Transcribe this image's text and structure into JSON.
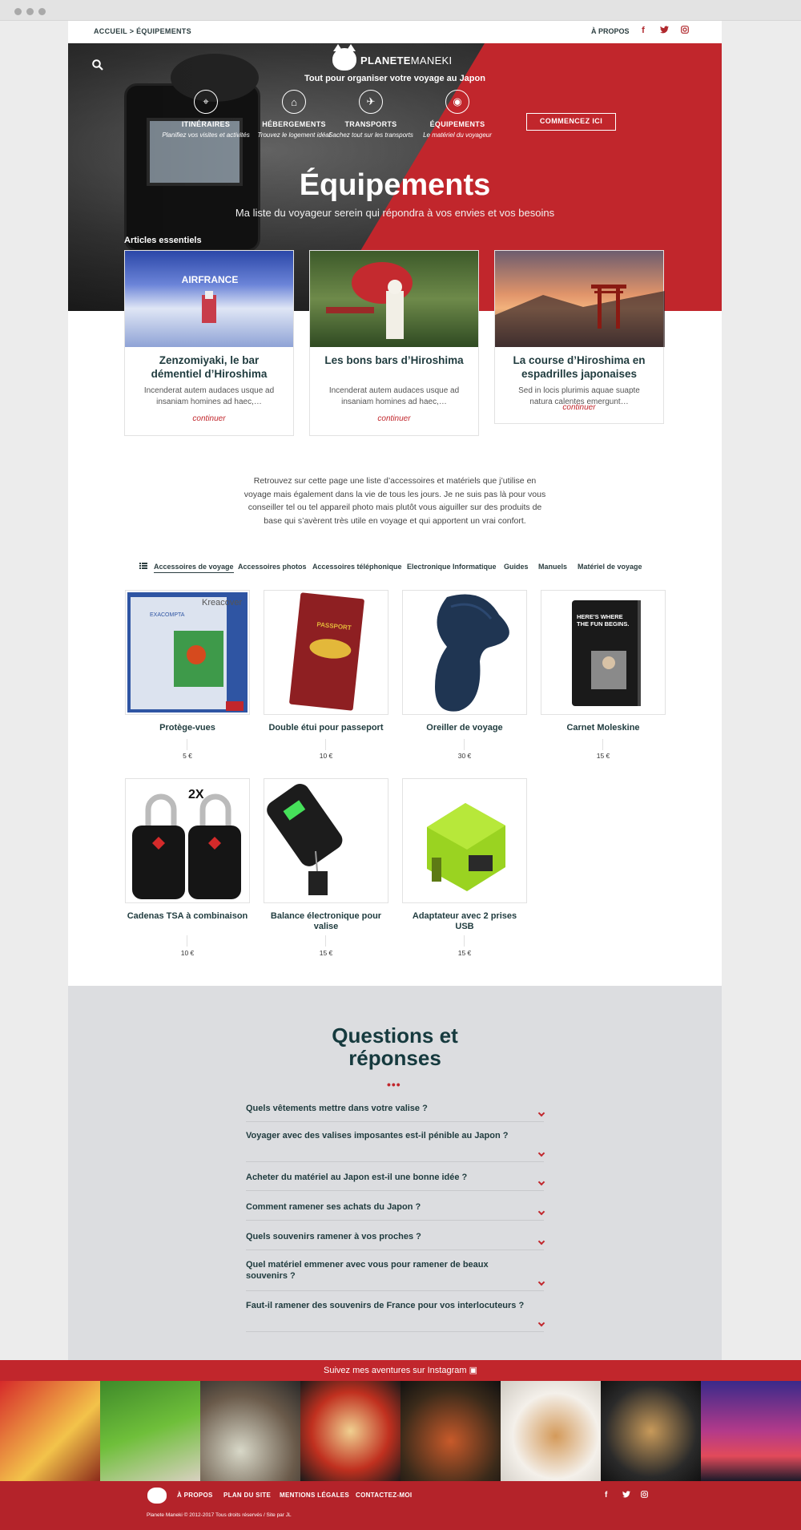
{
  "topbar": {
    "breadcrumb": "ACCUEIL > ÉQUIPEMENTS",
    "about": "À PROPOS",
    "social": [
      "f",
      "t",
      "ig"
    ]
  },
  "brand": {
    "name_bold": "PLANETE",
    "name_light": "MANEKI",
    "tagline": "Tout pour organiser votre voyage au Japon"
  },
  "nav": [
    {
      "title": "ITINÉRAIRES",
      "sub": "Planifiez vos visites et activités",
      "icon": "compass-icon"
    },
    {
      "title": "HÉBERGEMENTS",
      "sub": "Trouvez le logement idéal",
      "icon": "hotel-icon"
    },
    {
      "title": "TRANSPORTS",
      "sub": "Sachez tout sur les transports",
      "icon": "transport-icon"
    },
    {
      "title": "ÉQUIPEMENTS",
      "sub": "Le matériel du voyageur",
      "icon": "camera-icon"
    }
  ],
  "cta": "COMMENCEZ ICI",
  "hero": {
    "title": "Équipements",
    "subtitle": "Ma liste du voyageur serein qui répondra à vos envies et vos besoins",
    "section": "Articles essentiels"
  },
  "articles": [
    {
      "title": "Zenzomiyaki, le bar démentiel d’Hiroshima",
      "excerpt": "Incenderat autem audaces usque ad insaniam homines ad haec,…",
      "more": "continuer"
    },
    {
      "title": "Les bons bars d’Hiroshima",
      "excerpt": "Incenderat autem audaces usque ad insaniam homines ad haec,…",
      "more": "continuer"
    },
    {
      "title": "La course d’Hiroshima en espadrilles japonaises",
      "excerpt": "Sed in locis plurimis aquae suapte natura calentes emergunt…",
      "more": "continuer"
    }
  ],
  "intro": "Retrouvez sur cette page une liste d’accessoires et matériels que j’utilise en voyage mais également dans la vie de tous les jours. Je ne suis pas là pour vous conseiller tel ou tel appareil photo mais plutôt vous aiguiller sur des produits de base qui s’avèrent très utile en voyage et qui apportent un vrai confort.",
  "tabs": [
    "Accessoires de voyage",
    "Accessoires photos",
    "Accessoires téléphonique",
    "Electronique Informatique",
    "Guides",
    "Manuels",
    "Matériel de voyage"
  ],
  "products": [
    {
      "name": "Protège-vues",
      "price": "5 €"
    },
    {
      "name": "Double étui pour passeport",
      "price": "10 €"
    },
    {
      "name": "Oreiller de voyage",
      "price": "30 €"
    },
    {
      "name": "Carnet Moleskine",
      "price": "15 €"
    },
    {
      "name": "Cadenas TSA à combinaison",
      "price": "10 €"
    },
    {
      "name": "Balance électronique pour valise",
      "price": "15 €"
    },
    {
      "name": "Adaptateur avec 2 prises USB",
      "price": "15 €"
    }
  ],
  "product_image_text": {
    "kreacover": "Kreacover",
    "exacompta": "EXACOMPTA",
    "passport": "PASSPORT",
    "moleskine": "HERE'S WHERE THE FUN BEGINS.",
    "lock_count": "2X"
  },
  "faq": {
    "title_line1": "Questions et",
    "title_line2": "réponses",
    "dots": "•••",
    "questions": [
      "Quels vêtements mettre dans votre valise ?",
      "Voyager avec des valises imposantes est-il pénible au Japon ?",
      "Acheter du matériel au Japon est-il une bonne idée ?",
      "Comment ramener ses achats du Japon ?",
      "Quels souvenirs ramener à vos proches ?",
      "Quel matériel emmener avec vous pour ramener de beaux souvenirs ?",
      "Faut-il ramener des souvenirs de France pour vos interlocuteurs ?"
    ]
  },
  "instagram": "Suivez mes aventures sur Instagram",
  "footer": {
    "links": [
      "À PROPOS",
      "PLAN DU SITE",
      "MENTIONS LÉGALES",
      "CONTACTEZ-MOI"
    ],
    "copyright": "Planete Maneki © 2012-2017 Tous droits réservés / Site par JL"
  },
  "colors": {
    "accent": "#c1262c",
    "dark_text": "#1f3b3e",
    "faq_bg": "#dcdde0",
    "page_bg": "#ececec"
  }
}
